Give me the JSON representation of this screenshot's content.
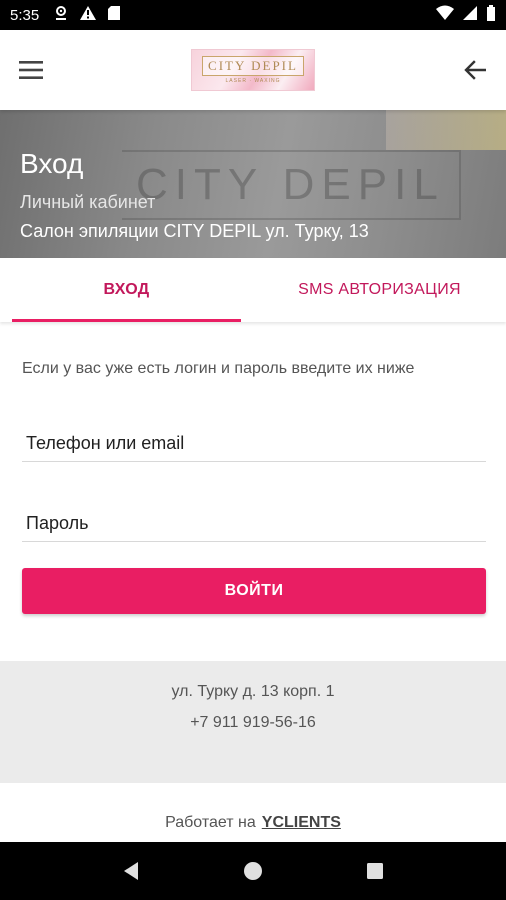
{
  "status_bar": {
    "time": "5:35",
    "left_icons": [
      "location-icon",
      "warning-icon",
      "sd-card-icon"
    ],
    "right_icons": [
      "wifi-icon",
      "signal-icon",
      "battery-icon"
    ]
  },
  "app_bar": {
    "logo_text": "CITY DEPIL",
    "logo_subtext": "LASER · WAXING",
    "menu_icon": "hamburger-menu-icon",
    "back_icon": "arrow-back-icon"
  },
  "hero": {
    "title": "Вход",
    "subtitle": "Личный кабинет",
    "salon": "Салон эпиляции CITY DEPIL ул. Турку, 13",
    "background_text": "CITY DEPIL"
  },
  "tabs": [
    {
      "label": "ВХОД",
      "active": true
    },
    {
      "label": "SMS АВТОРИЗАЦИЯ",
      "active": false
    }
  ],
  "form": {
    "intro": "Если у вас уже есть логин и пароль введите их ниже",
    "phone_placeholder": "Телефон или email",
    "phone_value": "",
    "password_placeholder": "Пароль",
    "password_value": "",
    "submit_label": "ВОЙТИ"
  },
  "contact": {
    "address": "ул. Турку д. 13 корп. 1",
    "phone": "+7 911 919-56-16"
  },
  "footer": {
    "powered_prefix": "Работает на",
    "powered_link": "YCLIENTS"
  },
  "colors": {
    "accent": "#e91e63",
    "tab_text": "#c2185b",
    "contact_bg": "#ebebeb"
  }
}
